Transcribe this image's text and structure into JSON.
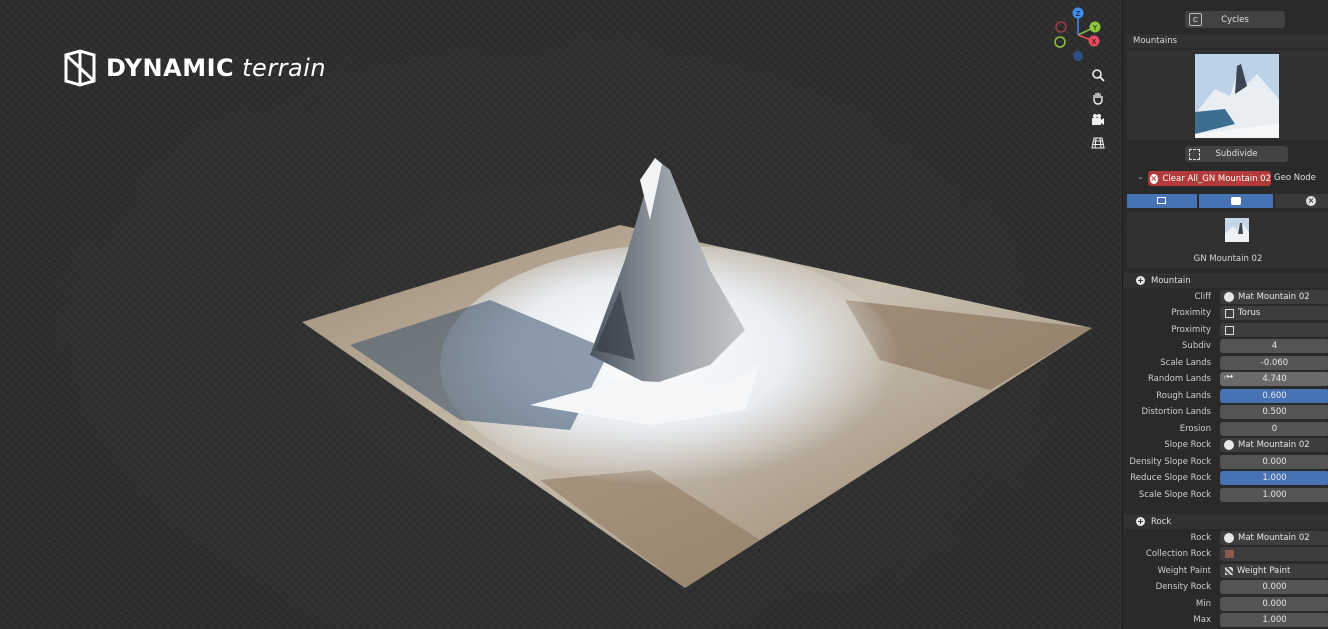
{
  "brand": {
    "word1": "DYNAMIC",
    "word2": "terrain"
  },
  "gizmo": {
    "z": "Z",
    "y": "Y",
    "x": "X",
    "colors": {
      "x": "#e64b5d",
      "y": "#8cc63f",
      "z": "#3e8fe8"
    }
  },
  "viewport_nav": [
    "zoom-icon",
    "hand-pan-icon",
    "camera-icon",
    "grid-icon"
  ],
  "panel": {
    "render_engine": "Cycles",
    "render_badge": "C",
    "asset_category": "Mountains",
    "subdivide_label": "Subdivide",
    "clear_label": "Clear All_GN Mountain 02",
    "geo_node_label": "Geo Node",
    "node_name": "GN Mountain 02",
    "mountain": {
      "title": "Mountain",
      "rows": [
        {
          "label": "Cliff",
          "value": "Mat Mountain 02"
        },
        {
          "label": "Proximity",
          "value": "Torus"
        },
        {
          "label": "Proximity",
          "value": ""
        },
        {
          "label": "Subdiv",
          "value": "4"
        },
        {
          "label": "Scale Lands",
          "value": "-0.060"
        },
        {
          "label": "Random Lands",
          "value": "4.740"
        },
        {
          "label": "Rough Lands",
          "value": "0.600"
        },
        {
          "label": "Distortion Lands",
          "value": "0.500"
        },
        {
          "label": "Erosion",
          "value": "0"
        },
        {
          "label": "Slope Rock",
          "value": "Mat Mountain 02"
        },
        {
          "label": "Density Slope Rock",
          "value": "0.000"
        },
        {
          "label": "Reduce Slope Rock",
          "value": "1.000"
        },
        {
          "label": "Scale Slope Rock",
          "value": "1.000"
        }
      ]
    },
    "rock": {
      "title": "Rock",
      "rows": [
        {
          "label": "Rock",
          "value": "Mat Mountain 02"
        },
        {
          "label": "Collection Rock",
          "value": ""
        },
        {
          "label": "Weight Paint",
          "value": "Weight Paint"
        },
        {
          "label": "Density Rock",
          "value": "0.000"
        },
        {
          "label": "Min",
          "value": "0.000"
        },
        {
          "label": "Max",
          "value": "1.000"
        }
      ]
    }
  }
}
